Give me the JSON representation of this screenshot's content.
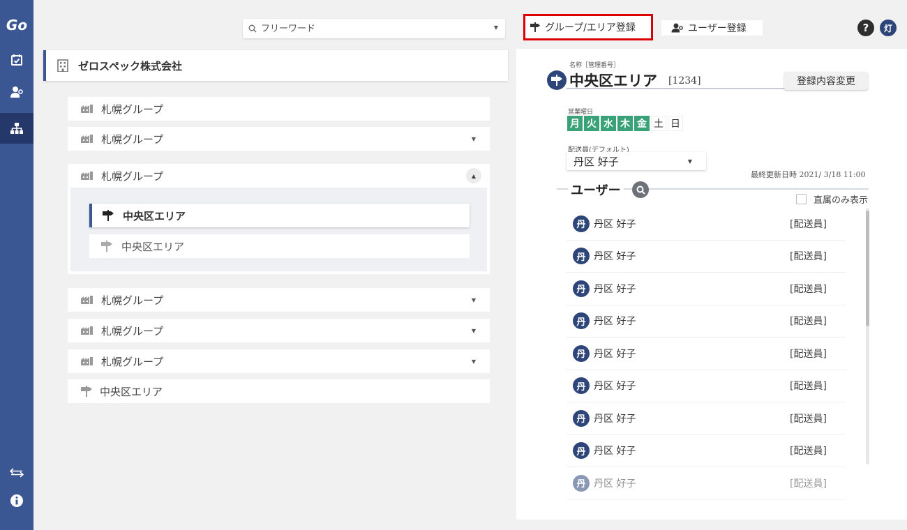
{
  "app": {
    "logo": "Go"
  },
  "sidebar": {
    "items": [
      {
        "icon": "calendar-check-icon",
        "active": false
      },
      {
        "icon": "user-gear-icon",
        "active": false
      },
      {
        "icon": "org-chart-icon",
        "active": true
      }
    ],
    "bottom": [
      {
        "icon": "swap-arrows-icon"
      },
      {
        "icon": "info-icon"
      }
    ]
  },
  "search": {
    "placeholder": "フリーワード"
  },
  "toolbar": {
    "group_area_register": "グループ/エリア登録",
    "user_register": "ユーザー登録",
    "help": "?",
    "user_initial": "灯"
  },
  "tree": {
    "company": "ゼロスペック株式会社",
    "groups_top": [
      {
        "label": "札幌グループ",
        "has_caret": false
      },
      {
        "label": "札幌グループ",
        "has_caret": true
      }
    ],
    "expanded_group": {
      "label": "札幌グループ",
      "areas": [
        {
          "label": "中央区エリア",
          "selected": true
        },
        {
          "label": "中央区エリア",
          "selected": false
        }
      ]
    },
    "groups_bottom": [
      {
        "label": "札幌グループ"
      },
      {
        "label": "札幌グループ"
      },
      {
        "label": "札幌グループ"
      }
    ],
    "loose_area": "中央区エリア"
  },
  "detail": {
    "name_caption": "名称［管理番号］",
    "name": "中央区エリア",
    "code": "[1234]",
    "edit_button": "登録内容変更",
    "days_caption": "営業曜日",
    "days": [
      {
        "label": "月",
        "on": true
      },
      {
        "label": "火",
        "on": true
      },
      {
        "label": "水",
        "on": true
      },
      {
        "label": "木",
        "on": true
      },
      {
        "label": "金",
        "on": true
      },
      {
        "label": "土",
        "on": false
      },
      {
        "label": "日",
        "on": false
      }
    ],
    "delivery_caption": "配送員(デフォルト)",
    "delivery_value": "丹区 好子",
    "updated": "最終更新日時 2021/ 3/18 11:00",
    "users_title": "ユーザー",
    "direct_only_label": "直属のみ表示",
    "accent_color": "#3aa278",
    "users": [
      {
        "initial": "丹",
        "name": "丹区 好子",
        "role": "[配送員]"
      },
      {
        "initial": "丹",
        "name": "丹区 好子",
        "role": "[配送員]"
      },
      {
        "initial": "丹",
        "name": "丹区 好子",
        "role": "[配送員]"
      },
      {
        "initial": "丹",
        "name": "丹区 好子",
        "role": "[配送員]"
      },
      {
        "initial": "丹",
        "name": "丹区 好子",
        "role": "[配送員]"
      },
      {
        "initial": "丹",
        "name": "丹区 好子",
        "role": "[配送員]"
      },
      {
        "initial": "丹",
        "name": "丹区 好子",
        "role": "[配送員]"
      },
      {
        "initial": "丹",
        "name": "丹区 好子",
        "role": "[配送員]"
      },
      {
        "initial": "丹",
        "name": "丹区 好子",
        "role": "[配送員]"
      }
    ]
  }
}
